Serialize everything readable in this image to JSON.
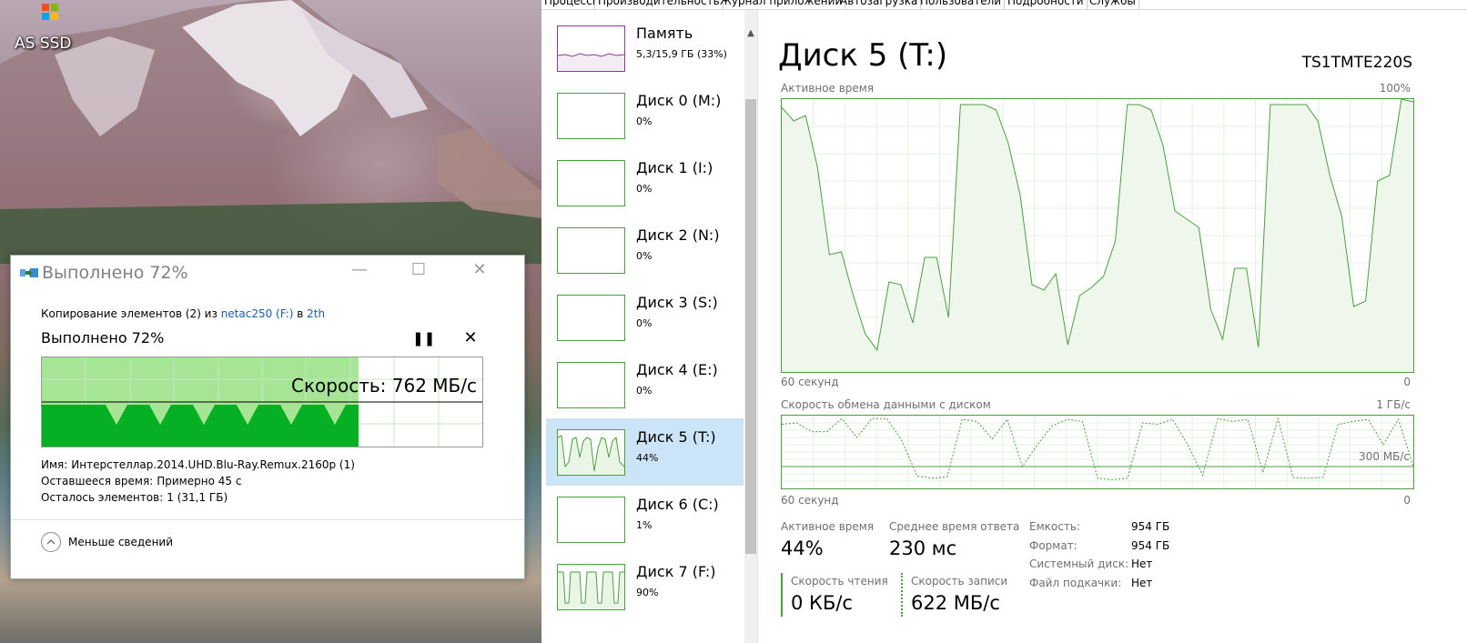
{
  "desktop": {
    "icon_label": "AS SSD"
  },
  "copy_dialog": {
    "title": "Выполнено 72%",
    "copy_prefix": "Копирование элементов (2) из ",
    "source": "netac250 (F:)",
    "to_word": " в ",
    "destination": "2th",
    "progress_text": "Выполнено 72%",
    "progress": 0.72,
    "speed_label": "Скорость: 762 МБ/с",
    "name_label": "Имя:",
    "name_value": "Интерстеллар.2014.UHD.Blu-Ray.Remux.2160p (1)",
    "time_label": "Оставшееся время:",
    "time_value": "Примерно 45 с",
    "items_label": "Осталось элементов:",
    "items_value": "1 (31,1 ГБ)",
    "less_details": "Меньше сведений",
    "colors": {
      "progress_fill": "#a6e596",
      "speed_fill": "#06b025"
    }
  },
  "taskmgr": {
    "tabs": [
      "Процессы",
      "Производительность",
      "Журнал приложений",
      "Автозагрузка",
      "Пользователи",
      "Подробности",
      "Службы"
    ],
    "active_tab": "Производительность",
    "devices": [
      {
        "name": "Память",
        "value": "5,3/15,9 ГБ (33%)",
        "type": "memory"
      },
      {
        "name": "Диск 0 (M:)",
        "value": "0%"
      },
      {
        "name": "Диск 1 (I:)",
        "value": "0%"
      },
      {
        "name": "Диск 2 (N:)",
        "value": "0%"
      },
      {
        "name": "Диск 3 (S:)",
        "value": "0%"
      },
      {
        "name": "Диск 4 (E:)",
        "value": "0%"
      },
      {
        "name": "Диск 5 (T:)",
        "value": "44%",
        "selected": true
      },
      {
        "name": "Диск 6 (C:)",
        "value": "1%"
      },
      {
        "name": "Диск 7 (F:)",
        "value": "90%"
      }
    ],
    "detail": {
      "title": "Диск 5 (T:)",
      "model": "TS1TMTE220S",
      "graph1_label": "Активное время",
      "graph1_max": "100%",
      "graph1_time": "60 секунд",
      "graph1_min": "0",
      "graph2_label": "Скорость обмена данными с диском",
      "graph2_max": "1 ГБ/с",
      "graph2_mid": "300 МБ/с",
      "graph2_time": "60 секунд",
      "graph2_min": "0",
      "active_time_label": "Активное время",
      "active_time_value": "44%",
      "response_label": "Среднее время ответа",
      "response_value": "230 мс",
      "read_label": "Скорость чтения",
      "read_value": "0 КБ/с",
      "write_label": "Скорость записи",
      "write_value": "622 МБ/с",
      "props": [
        {
          "k": "Емкость:",
          "v": "954 ГБ"
        },
        {
          "k": "Формат:",
          "v": "954 ГБ"
        },
        {
          "k": "Системный диск:",
          "v": "Нет"
        },
        {
          "k": "Файл подкачки:",
          "v": "Нет"
        }
      ],
      "colors": {
        "disk": "#4aa03d",
        "disk_fill": "#eff7ec",
        "memory": "#8b3a99"
      }
    }
  }
}
